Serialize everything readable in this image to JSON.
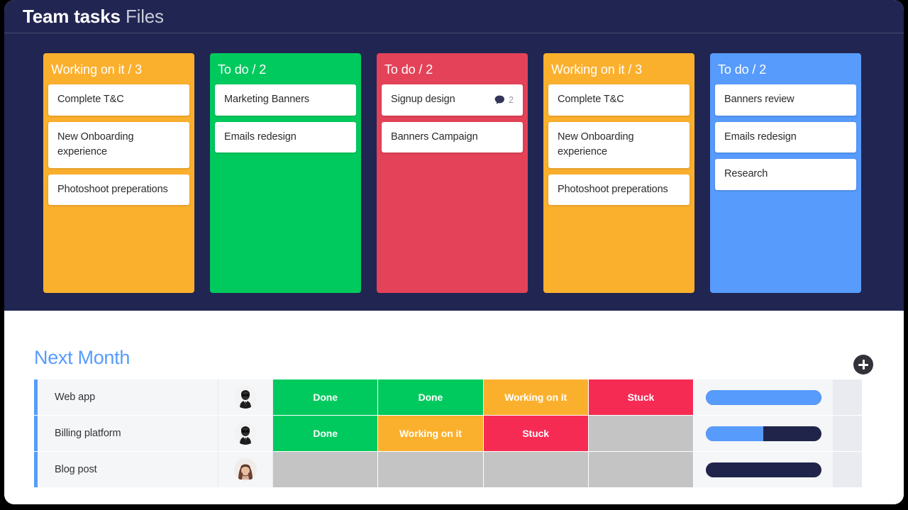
{
  "board": {
    "title_primary": "Team tasks",
    "title_secondary": "Files",
    "background_color": "#212551",
    "columns": [
      {
        "title": "Working on it / 3",
        "color": "#fbb02d",
        "cards": [
          {
            "title": "Complete T&C",
            "badge_icon": "",
            "badge_count": ""
          },
          {
            "title": "New Onboarding experience",
            "badge_icon": "",
            "badge_count": ""
          },
          {
            "title": "Photoshoot preperations",
            "badge_icon": "",
            "badge_count": ""
          }
        ]
      },
      {
        "title": "To do / 2",
        "color": "#00ca5e",
        "cards": [
          {
            "title": "Marketing Banners",
            "badge_icon": "",
            "badge_count": ""
          },
          {
            "title": "Emails redesign",
            "badge_icon": "",
            "badge_count": ""
          }
        ]
      },
      {
        "title": "To do / 2",
        "color": "#e44258",
        "cards": [
          {
            "title": "Signup design",
            "badge_icon": "comment-icon",
            "badge_count": "2"
          },
          {
            "title": "Banners Campaign",
            "badge_icon": "",
            "badge_count": ""
          }
        ]
      },
      {
        "title": "Working on it / 3",
        "color": "#fbb02d",
        "cards": [
          {
            "title": "Complete T&C",
            "badge_icon": "",
            "badge_count": ""
          },
          {
            "title": "New Onboarding experience",
            "badge_icon": "",
            "badge_count": ""
          },
          {
            "title": "Photoshoot preperations",
            "badge_icon": "",
            "badge_count": ""
          }
        ]
      },
      {
        "title": "To do / 2",
        "color": "#579bfc",
        "cards": [
          {
            "title": "Banners review",
            "badge_icon": "",
            "badge_count": ""
          },
          {
            "title": "Emails redesign",
            "badge_icon": "",
            "badge_count": ""
          },
          {
            "title": "Research",
            "badge_icon": "",
            "badge_count": ""
          }
        ]
      }
    ]
  },
  "table": {
    "title": "Next Month",
    "title_color": "#579bfc",
    "add_button_label": "+",
    "accent_color": "#579bfc",
    "status_colors": {
      "done": "#00ca5e",
      "working": "#fbb02d",
      "stuck": "#e8征",
      "stuck_hex": "#f62b54",
      "empty": "#c4c4c4"
    },
    "rows": [
      {
        "name": "Web app",
        "avatar": "avatar-man",
        "statuses": [
          {
            "label": "Done",
            "color": "#00ca5e"
          },
          {
            "label": "Done",
            "color": "#00ca5e"
          },
          {
            "label": "Working on it",
            "color": "#fbb02d"
          },
          {
            "label": "Stuck",
            "color": "#f62b54"
          }
        ],
        "progress_percent": 100
      },
      {
        "name": "Billing platform",
        "avatar": "avatar-man",
        "statuses": [
          {
            "label": "Done",
            "color": "#00ca5e"
          },
          {
            "label": "Working on it",
            "color": "#fbb02d"
          },
          {
            "label": "Stuck",
            "color": "#f62b54"
          },
          {
            "label": "",
            "color": "#c4c4c4"
          }
        ],
        "progress_percent": 50
      },
      {
        "name": "Blog post",
        "avatar": "avatar-woman",
        "statuses": [
          {
            "label": "",
            "color": "#c4c4c4"
          },
          {
            "label": "",
            "color": "#c4c4c4"
          },
          {
            "label": "",
            "color": "#c4c4c4"
          },
          {
            "label": "",
            "color": "#c4c4c4"
          }
        ],
        "progress_percent": 0
      }
    ]
  }
}
